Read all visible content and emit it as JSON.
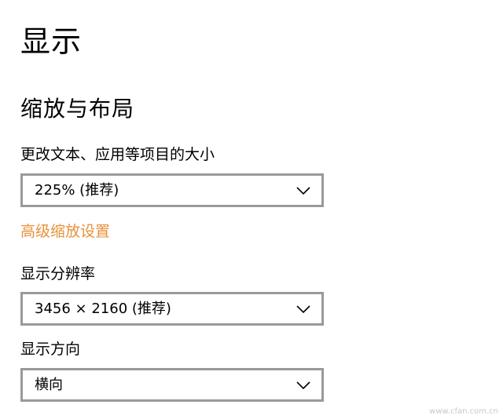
{
  "page": {
    "title": "显示"
  },
  "scale_layout": {
    "section_title": "缩放与布局",
    "text_size_label": "更改文本、应用等项目的大小",
    "text_size_value": "225% (推荐)",
    "advanced_link": "高级缩放设置",
    "resolution_label": "显示分辨率",
    "resolution_value": "3456 × 2160 (推荐)",
    "orientation_label": "显示方向",
    "orientation_value": "横向"
  },
  "watermark": {
    "text": "www.cfan.com.cn"
  },
  "colors": {
    "link": "#e8913a",
    "dropdown_border": "#999999",
    "text": "#000000"
  },
  "icons": {
    "dropdown_arrow": "chevron-down-icon"
  }
}
